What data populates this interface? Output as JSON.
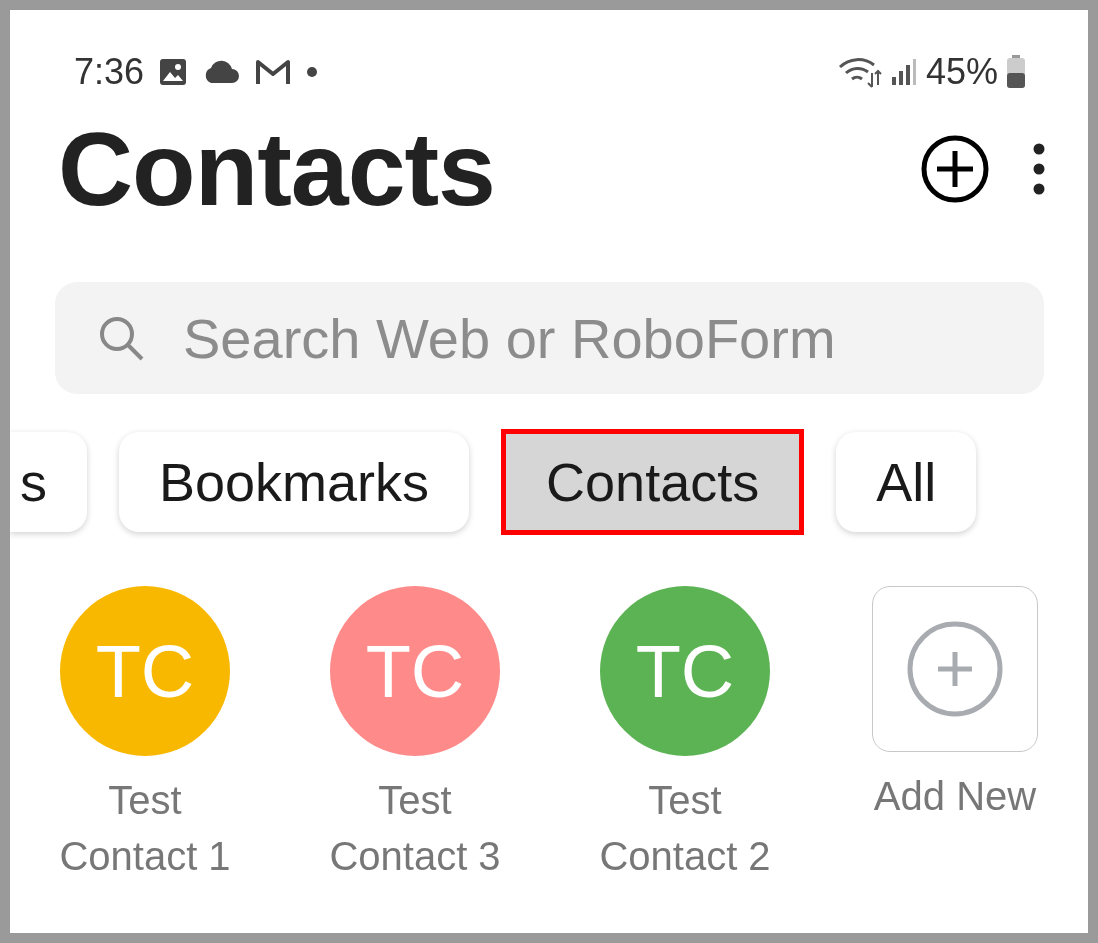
{
  "status_bar": {
    "time": "7:36",
    "battery": "45%"
  },
  "header": {
    "title": "Contacts"
  },
  "search": {
    "placeholder": "Search Web or RoboForm"
  },
  "filters": [
    {
      "label": "s",
      "selected": false
    },
    {
      "label": "Bookmarks",
      "selected": false
    },
    {
      "label": "Contacts",
      "selected": true
    },
    {
      "label": "All",
      "selected": false
    }
  ],
  "contacts": [
    {
      "kind": "contact",
      "initials": "TC",
      "name": "Test Contact 1",
      "color": "#f9b800"
    },
    {
      "kind": "contact",
      "initials": "TC",
      "name": "Test Contact 3",
      "color": "#ff8a8a"
    },
    {
      "kind": "contact",
      "initials": "TC",
      "name": "Test Contact 2",
      "color": "#5cb354"
    },
    {
      "kind": "add",
      "name": "Add New"
    }
  ]
}
